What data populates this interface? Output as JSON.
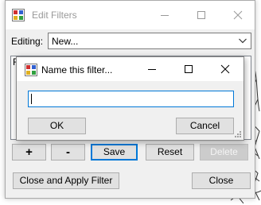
{
  "window": {
    "title": "Edit Filters",
    "editing_label": "Editing:",
    "editing_value": "New...",
    "list_partial_char": "F",
    "buttons": {
      "add": "+",
      "remove": "-",
      "save": "Save",
      "reset": "Reset",
      "delete": "Delete",
      "close_apply": "Close and Apply Filter",
      "close": "Close"
    }
  },
  "dialog": {
    "title": "Name this filter...",
    "input_value": "",
    "ok": "OK",
    "cancel": "Cancel"
  },
  "colors": {
    "accent": "#0078d7",
    "window_bg": "#f0f0f0",
    "button_bg": "#e1e1e1"
  }
}
